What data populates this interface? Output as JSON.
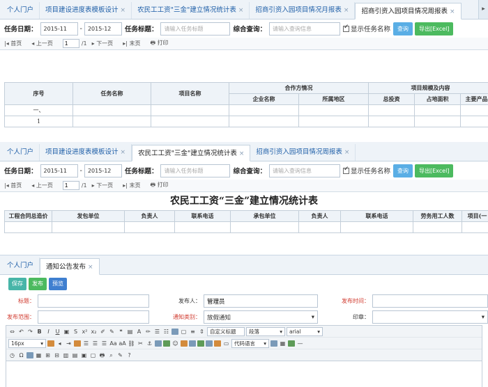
{
  "panel1": {
    "tabs": [
      {
        "label": "个人门户",
        "closable": false
      },
      {
        "label": "项目建设进度表模板设计",
        "closable": true
      },
      {
        "label": "农民工工资\"三金\"建立情况统计表",
        "closable": true
      },
      {
        "label": "招商引资入园项目情况月报表",
        "closable": true
      },
      {
        "label": "招商引资入园项目情况周报表",
        "closable": true
      }
    ],
    "close_symbol": "×",
    "filter": {
      "date_label": "任务日期：",
      "date_from": "2015-11",
      "date_to": "2015-12",
      "title_label": "任务标题：",
      "title_placeholder": "请输入任务标题",
      "query_label": "综合查询：",
      "query_placeholder": "请输入查询信息",
      "show_name_label": "显示任务名称",
      "search_button": "查询",
      "export_button": "导出[Excel]"
    },
    "pager": {
      "first": "首页",
      "prev": "上一页",
      "page": "1",
      "total": "/1",
      "next": "下一页",
      "last": "末页",
      "print": "打印"
    },
    "table": {
      "group_cooperation": "合作方情况",
      "group_scale": "项目规模及内容",
      "headers": [
        "序号",
        "任务名称",
        "项目名称",
        "企业名称",
        "所属地区",
        "总投资",
        "占地面积",
        "主要产品"
      ],
      "rows": [
        [
          "一、",
          "",
          "",
          "",
          "",
          "",
          "",
          ""
        ],
        [
          "1",
          "",
          "",
          "",
          "",
          "",
          "",
          ""
        ]
      ]
    }
  },
  "panel2": {
    "tabs": [
      {
        "label": "个人门户",
        "closable": false
      },
      {
        "label": "项目建设进度表模板设计",
        "closable": true
      },
      {
        "label": "农民工工资\"三金\"建立情况统计表",
        "closable": true
      },
      {
        "label": "招商引资入园项目情况周报表",
        "closable": true
      }
    ],
    "report_title": "农民工工资“三金”建立情况统计表",
    "headers": [
      "工程合同总造价",
      "发包单位",
      "负责人",
      "联系电话",
      "承包单位",
      "负责人",
      "联系电话",
      "劳务用工人数",
      "项目(一"
    ]
  },
  "panel3": {
    "tabs": [
      {
        "label": "个人门户",
        "closable": false
      },
      {
        "label": "通知公告发布",
        "closable": true
      }
    ],
    "buttons": {
      "save": "保存",
      "publish": "发布",
      "preview": "预览"
    },
    "form": {
      "title_label": "标题：",
      "publisher_label": "发布人：",
      "publisher_value": "管理员",
      "publish_time_label": "发布时间：",
      "scope_label": "发布范围：",
      "category_label": "通知类别：",
      "category_value": "放假通知",
      "seal_label": "印章："
    },
    "editor": {
      "custom_title": "自定义标题",
      "paragraph": "段落",
      "font": "arial",
      "font_size": "16px",
      "code_lang": "代码语言"
    }
  }
}
